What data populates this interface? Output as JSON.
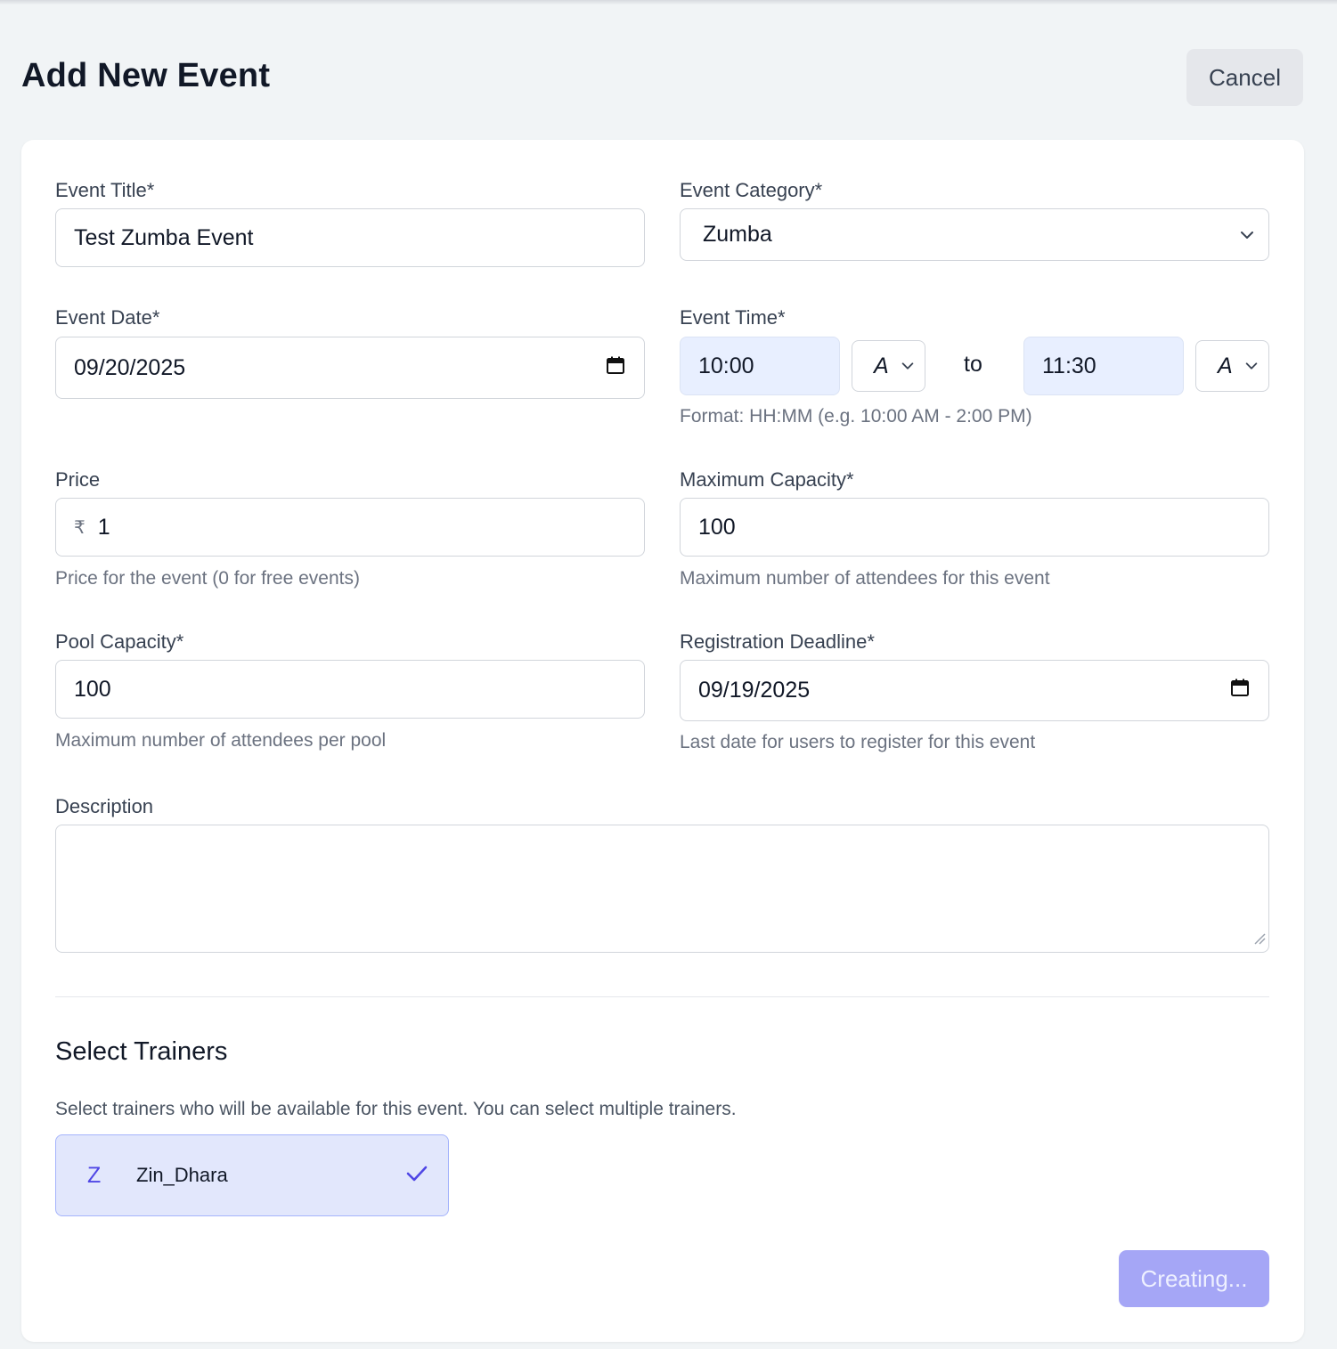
{
  "header": {
    "title": "Add New Event",
    "cancel_label": "Cancel"
  },
  "form": {
    "event_title": {
      "label": "Event Title*",
      "value": "Test Zumba Event"
    },
    "event_category": {
      "label": "Event Category*",
      "value": "Zumba"
    },
    "event_date": {
      "label": "Event Date*",
      "value": "09/20/2025"
    },
    "event_time": {
      "label": "Event Time*",
      "start": "10:00",
      "start_period": "A",
      "separator": "to",
      "end": "11:30",
      "end_period": "A",
      "help": "Format: HH:MM (e.g. 10:00 AM - 2:00 PM)"
    },
    "price": {
      "label": "Price",
      "currency": "₹",
      "value": "1",
      "help": "Price for the event (0 for free events)"
    },
    "max_capacity": {
      "label": "Maximum Capacity*",
      "value": "100",
      "help": "Maximum number of attendees for this event"
    },
    "pool_capacity": {
      "label": "Pool Capacity*",
      "value": "100",
      "help": "Maximum number of attendees per pool"
    },
    "registration_deadline": {
      "label": "Registration Deadline*",
      "value": "09/19/2025",
      "help": "Last date for users to register for this event"
    },
    "description": {
      "label": "Description",
      "value": ""
    }
  },
  "trainers": {
    "title": "Select Trainers",
    "help": "Select trainers who will be available for this event. You can select multiple trainers.",
    "items": [
      {
        "initial": "Z",
        "name": "Zin_Dhara",
        "selected": true
      }
    ]
  },
  "submit_label": "Creating...",
  "colors": {
    "accent": "#4f46e5",
    "selected_bg": "#e2e7fc",
    "submit_disabled": "#a5a6f6",
    "time_input_bg": "#e8efff"
  }
}
